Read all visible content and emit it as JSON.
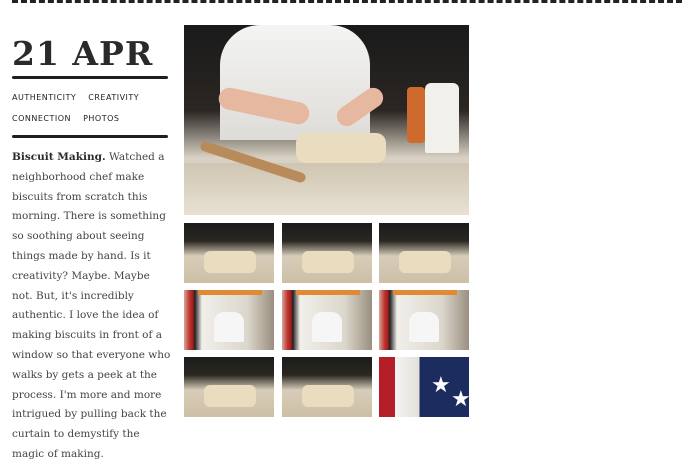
{
  "post": {
    "date": "21 APR",
    "tags": [
      "AUTHENTICITY",
      "CREATIVITY",
      "CONNECTION",
      "PHOTOS"
    ],
    "body_title": "Biscuit Making.",
    "body_text": "Watched a neighborhood chef make biscuits from scratch this morning. There is something so soothing about seeing things made by hand.  Is it creativity? Maybe. Maybe not. But, it's incredibly authentic.  I love the idea of making biscuits in front of a window so that everyone who walks by gets a peek at the process.  I'm more and more intrigued by pulling back the curtain to demystify the magic of making."
  },
  "gallery": {
    "hero": "chef-kneading-biscuit-dough",
    "thumbs": [
      "chef-at-table",
      "dough-close-up",
      "cut-biscuits",
      "window-view-1",
      "window-view-2",
      "window-view-3",
      "hands-in-dough-1",
      "hands-in-dough-2",
      "flag-and-curtain"
    ]
  },
  "colors": {
    "ink": "#222222",
    "text": "#444444",
    "background": "#ffffff"
  }
}
